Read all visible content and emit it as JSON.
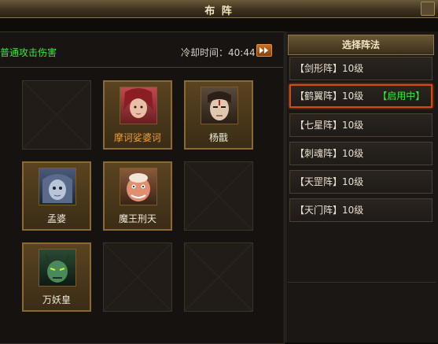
{
  "window": {
    "title": "布 阵"
  },
  "hint": {
    "text": "普通攻击伤害"
  },
  "cooldown": {
    "label": "冷却时间：",
    "value": "40:44"
  },
  "formation_panel": {
    "header": "选择阵法",
    "items": [
      {
        "label": "【剑形阵】10级",
        "status": ""
      },
      {
        "label": "【鹤翼阵】10级",
        "status": "【启用中】",
        "active": true
      },
      {
        "label": "【七星阵】10级",
        "status": ""
      },
      {
        "label": "【刺魂阵】10级",
        "status": ""
      },
      {
        "label": "【天罡阵】10级",
        "status": ""
      },
      {
        "label": "【天门阵】10级",
        "status": ""
      }
    ]
  },
  "grid": {
    "slots": [
      {
        "name": ""
      },
      {
        "name": "摩诃娑婆诃",
        "icon": "red-hair-woman-portrait"
      },
      {
        "name": "杨戬",
        "icon": "warrior-third-eye-portrait"
      },
      {
        "name": "孟婆",
        "icon": "pale-ghost-woman-portrait"
      },
      {
        "name": "魔王刑天",
        "icon": "demon-king-portrait"
      },
      {
        "name": ""
      },
      {
        "name": "万妖皇",
        "icon": "green-demon-portrait"
      },
      {
        "name": ""
      },
      {
        "name": ""
      }
    ]
  },
  "colors": {
    "accent_green": "#38e838",
    "active_border": "#d04a14",
    "gold_frame": "#8a6a32",
    "orange_name": "#f0a040"
  }
}
